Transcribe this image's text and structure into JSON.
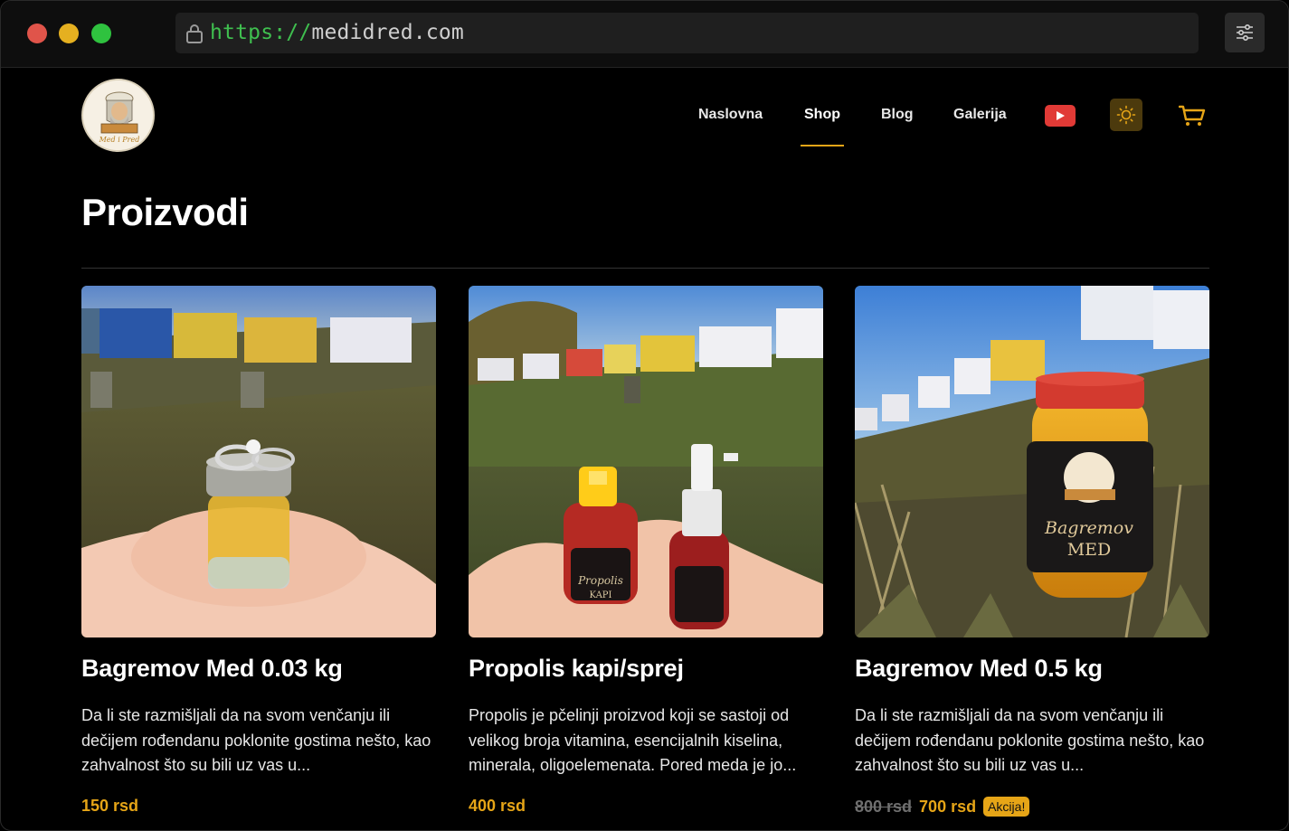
{
  "browser": {
    "url_scheme": "https://",
    "url_host": "medidred.com"
  },
  "header": {
    "logo_text": "Med i Pred",
    "nav": [
      {
        "label": "Naslovna",
        "active": false
      },
      {
        "label": "Shop",
        "active": true
      },
      {
        "label": "Blog",
        "active": false
      },
      {
        "label": "Galerija",
        "active": false
      }
    ],
    "icons": [
      "youtube-icon",
      "sun-icon",
      "cart-icon"
    ],
    "accent_color": "#e6a517"
  },
  "page": {
    "title": "Proizvodi"
  },
  "products": [
    {
      "title": "Bagremov Med 0.03 kg",
      "description": "Da li ste razmišljali da na svom venčanju ili dečijem rođendanu poklonite gostima nešto, kao zahvalnost što su bili uz vas u...",
      "price": "150 rsd",
      "old_price": "",
      "badge": ""
    },
    {
      "title": "Propolis kapi/sprej",
      "description": "Propolis je pčelinji proizvod koji se sastoji od velikog broja vitamina, esencijalnih kiselina, minerala, oligoelemenata. Pored meda je jo...",
      "price": "400 rsd",
      "old_price": "",
      "badge": ""
    },
    {
      "title": "Bagremov Med 0.5 kg",
      "description": "Da li ste razmišljali da na svom venčanju ili dečijem rođendanu poklonite gostima nešto, kao zahvalnost što su bili uz vas u...",
      "price": "700 rsd",
      "old_price": "800 rsd",
      "badge": "Akcija!"
    }
  ],
  "labels_on_images": {
    "propolis_label_1": "Propolis",
    "propolis_label_2": "KAPI",
    "jar_label_1": "Bagremov",
    "jar_label_2": "MED"
  }
}
